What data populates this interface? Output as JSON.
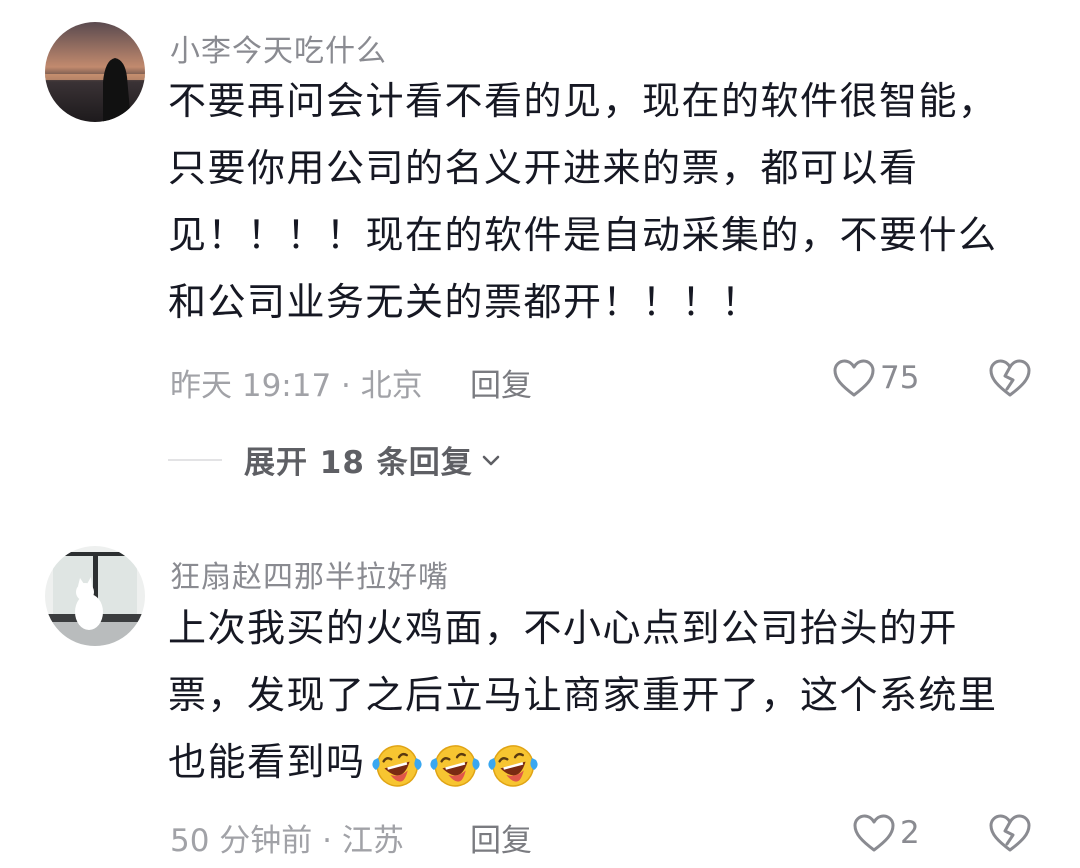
{
  "comments": [
    {
      "username": "小李今天吃什么",
      "lines": [
        "不要再问会计看不看的见，现在的软件很智能，",
        "只要你用公司的名义开进来的票，都可以看",
        "见！！！！现在的软件是自动采集的，不要什么",
        "和公司业务无关的票都开！！！！"
      ],
      "meta": "昨天 19:17 · 北京",
      "reply_label": "回复",
      "like_count": "75",
      "expand_label": "展开 18 条回复",
      "avatar_icon": "sunset-silhouette-avatar"
    },
    {
      "username": "狂扇赵四那半拉好嘴",
      "lines": [
        "上次我买的火鸡面，不小心点到公司抬头的开",
        "票，发现了之后立马让商家重开了，这个系统里",
        "也能看到吗"
      ],
      "emoji": "laughing-crying-emoji",
      "emoji_count": 3,
      "meta": "50 分钟前 · 江苏",
      "reply_label": "回复",
      "like_count": "2",
      "avatar_icon": "cat-window-avatar"
    }
  ],
  "colors": {
    "text": "#161823",
    "secondary": "#8a8b91",
    "meta": "#a1a2a7",
    "expand": "#5e5f64"
  }
}
